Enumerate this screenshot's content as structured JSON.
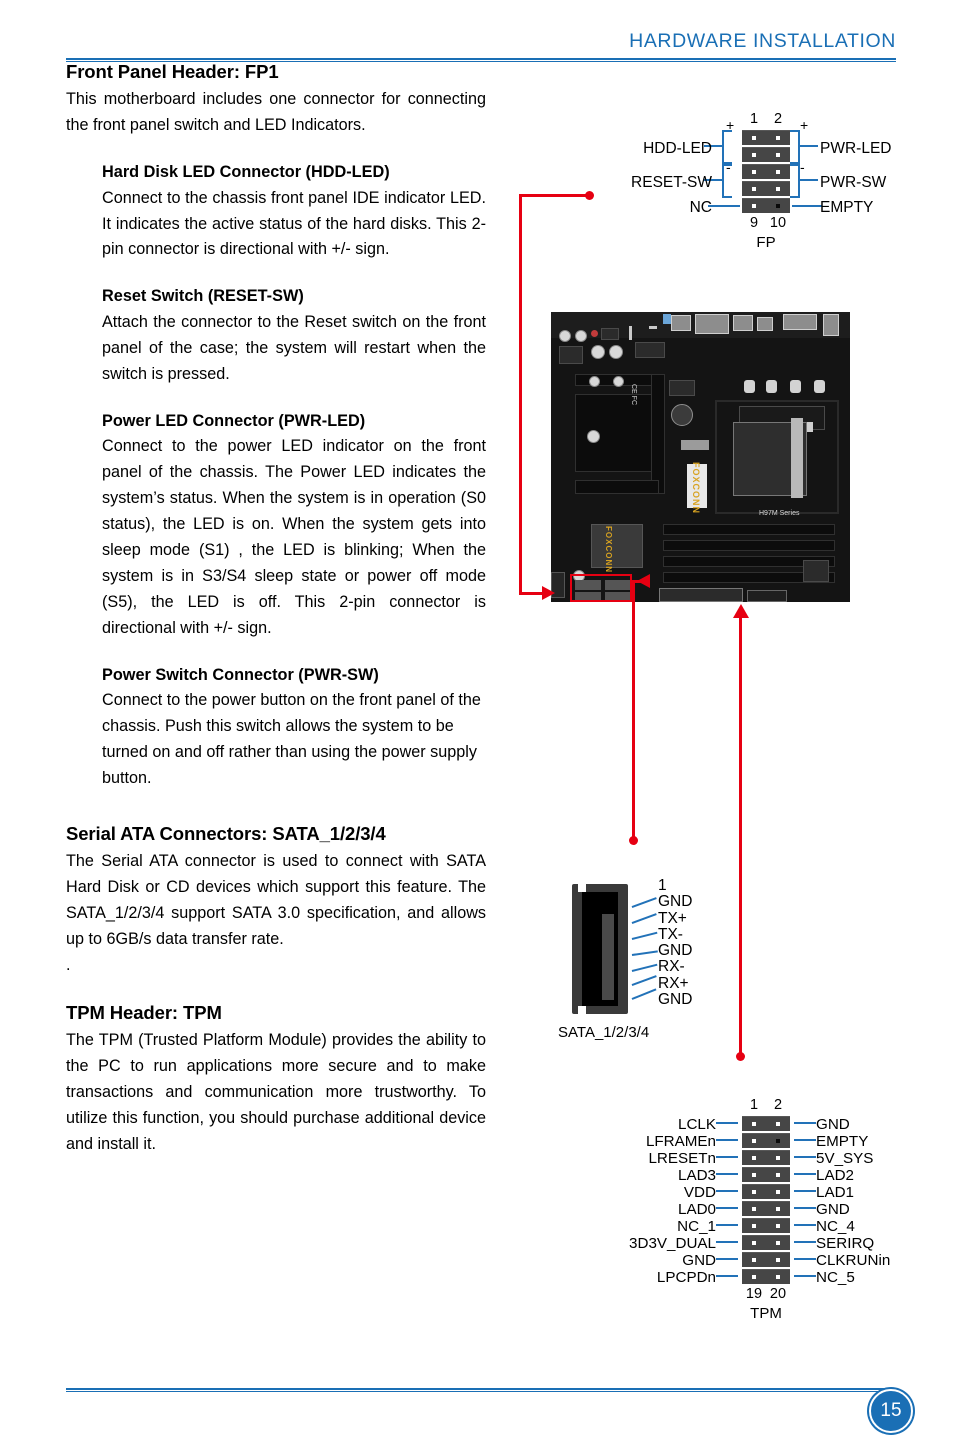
{
  "header": {
    "title": "HARDWARE INSTALLATION"
  },
  "footer": {
    "page_number": "15"
  },
  "content": {
    "fp1": {
      "title": "Front Panel Header: FP1",
      "intro": "This motherboard includes one connector for connecting the front panel switch and LED Indicators.",
      "subsections": [
        {
          "heading": "Hard Disk LED Connector (HDD-LED)",
          "body": "Connect to the chassis front panel IDE indicator LED. It indicates the active status of the hard disks. This 2-pin connector is directional with +/- sign."
        },
        {
          "heading": "Reset Switch (RESET-SW)",
          "body": "Attach the connector to the Reset switch on the front panel of the case; the system will restart when the switch is pressed."
        },
        {
          "heading": "Power LED Connector (PWR-LED)",
          "body": "Connect to the power LED indicator on the front panel of the chassis. The Power LED indicates the system’s status. When the system is in operation (S0 status), the LED is on. When the system gets into sleep mode (S1) , the LED is blinking; When the system is in S3/S4 sleep state or power off mode (S5), the LED is off. This 2-pin connector is directional with +/- sign."
        },
        {
          "heading": "Power Switch Connector (PWR-SW)",
          "body": "Connect to the power button on the front panel of the chassis. Push this switch allows the system to be turned on and off rather than using the power supply button."
        }
      ]
    },
    "sata": {
      "title": "Serial ATA Connectors: SATA_1/2/3/4",
      "body": "The Serial ATA connector is used to connect with SATA Hard Disk or CD devices which support this feature. The SATA_1/2/3/4 support SATA 3.0 specification,  and allows up to 6GB/s data transfer rate.",
      "trailing_dot": "."
    },
    "tpm": {
      "title": "TPM Header: TPM",
      "body": "The TPM (Trusted Platform Module) provides the ability to the PC to run applications more secure and to make transactions and communication more trustworthy. To utilize this function, you should purchase additional device and install it."
    }
  },
  "diagrams": {
    "fp1": {
      "name": "FP",
      "pin_top_left": "1",
      "pin_top_right": "2",
      "pin_bottom_left": "9",
      "pin_bottom_right": "10",
      "labels_left": [
        "HDD-LED",
        "RESET-SW",
        "NC"
      ],
      "labels_right": [
        "PWR-LED",
        "PWR-SW",
        "EMPTY"
      ],
      "signs": {
        "plus": "+",
        "minus": "-"
      },
      "rows": [
        {
          "left_pin": "filled",
          "right_pin": "filled"
        },
        {
          "left_pin": "filled",
          "right_pin": "filled"
        },
        {
          "left_pin": "filled",
          "right_pin": "filled"
        },
        {
          "left_pin": "filled",
          "right_pin": "filled"
        },
        {
          "left_pin": "filled",
          "right_pin": "empty"
        }
      ]
    },
    "sata": {
      "caption": "SATA_1/2/3/4",
      "pin_start": "1",
      "pins": [
        "GND",
        "TX+",
        "TX-",
        "GND",
        "RX-",
        "RX+",
        "GND"
      ]
    },
    "tpm": {
      "name": "TPM",
      "pin_top_left": "1",
      "pin_top_right": "2",
      "pin_bottom_left": "19",
      "pin_bottom_right": "20",
      "rows": [
        {
          "left": "LCLK",
          "right": "GND",
          "right_pin": "filled"
        },
        {
          "left": "LFRAMEn",
          "right": "EMPTY",
          "right_pin": "empty"
        },
        {
          "left": "LRESETn",
          "right": "5V_SYS",
          "right_pin": "filled"
        },
        {
          "left": "LAD3",
          "right": "LAD2",
          "right_pin": "filled"
        },
        {
          "left": "VDD",
          "right": "LAD1",
          "right_pin": "filled"
        },
        {
          "left": "LAD0",
          "right": "GND",
          "right_pin": "filled"
        },
        {
          "left": "NC_1",
          "right": "NC_4",
          "right_pin": "filled"
        },
        {
          "left": "3D3V_DUAL",
          "right": "SERIRQ",
          "right_pin": "filled"
        },
        {
          "left": "GND",
          "right": "CLKRUNin",
          "right_pin": "filled"
        },
        {
          "left": "LPCPDn",
          "right": "NC_5",
          "right_pin": "filled"
        }
      ]
    }
  },
  "motherboard": {
    "brand": "FOXCONN",
    "series": "H97M Series",
    "heatsink_text": "FOXCONN",
    "cert_text": "CE FC"
  },
  "colors": {
    "accent_blue": "#1a6fb5",
    "diagram_blue": "#2272b8",
    "callout_red": "#e60012",
    "connector_body": "#464646"
  }
}
